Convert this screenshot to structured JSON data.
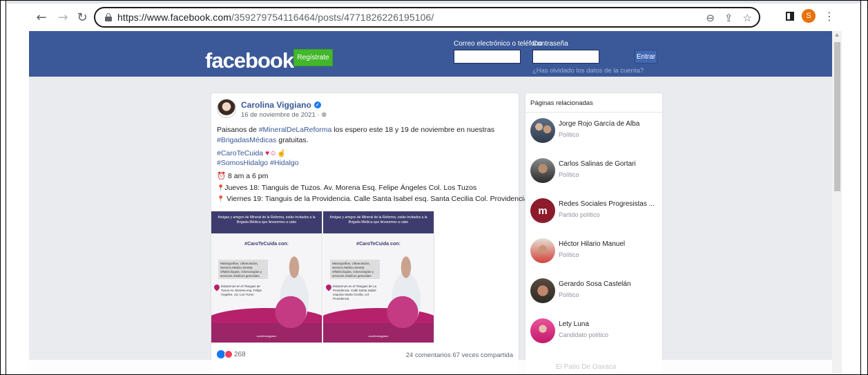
{
  "browser": {
    "url_host": "https://www.facebook.com",
    "url_path": "/359279754116464/posts/4771826226195106/",
    "profile_initial": "S"
  },
  "fb": {
    "logo": "facebook",
    "register": "Regístrate",
    "email_label": "Correo electrónico o teléfono",
    "password_label": "Contraseña",
    "login": "Entrar",
    "forgot": "¿Has olvidado los datos de la cuenta?"
  },
  "post": {
    "author": "Carolina Viggiano",
    "date": "16 de noviembre de 2021 · ",
    "line1_prefix": "Paisanos de ",
    "line1_tag": "#MineralDeLaReforma",
    "line1_suffix": " los espero este 18 y 19 de noviembre en nuestras",
    "line2_tag": "#BrigadasMédicas",
    "line2_suffix": " gratuitas.",
    "line3_tag": "#CaroTeCuida",
    "line4_tags": "#SomosHidalgo #Hidalgo",
    "hours": "8 am a 6 pm",
    "day1": "Jueves 18: Tianguis de Tuzos. Av. Morena Esq. Felipe Ángeles Col. Los Tuzos",
    "day2": "Viernes 19: Tianguis de la Providencia. Calle Santa Isabel esq. Santa Cecilia Col. Providencia.",
    "reaction_count": "268",
    "stats": "24 comentarios 67 veces compartida",
    "flyer": {
      "top": "Amigas y amigos de Mineral de la Reforma, están invitados a la Brigada Médica que llevaremos a cabo",
      "hashtag": "#CaroTeCuida con:",
      "services": "Mastografías, Ultrasonidos, Servicio Médico Dental, Oftalmologías, Ginecologías y servicios médicos generales.",
      "loc1": "Estaremos en el Tianguis de Tuzos Av. Morena esq. Felipe Ángeles, col. Los Tuzos",
      "loc2": "Estaremos en el Tianguis de La Providencia. Calle Santa Isabel esquina Santa Cecilia, col. Providencia",
      "footer": "carolinaviggiano"
    }
  },
  "related": {
    "title": "Páginas relacionadas",
    "items": [
      {
        "name": "Jorge Rojo García de Alba",
        "category": "Político"
      },
      {
        "name": "Carlos Salinas de Gortari",
        "category": "Político"
      },
      {
        "name": "Redes Sociales Progresistas ...",
        "category": "Partido político"
      },
      {
        "name": "Héctor Hilario Manuel",
        "category": "Político"
      },
      {
        "name": "Gerardo Sosa Castelán",
        "category": "Político"
      },
      {
        "name": "Lety Luna",
        "category": "Candidato político"
      }
    ],
    "faded_next": "El Patio De Oaxaca"
  }
}
